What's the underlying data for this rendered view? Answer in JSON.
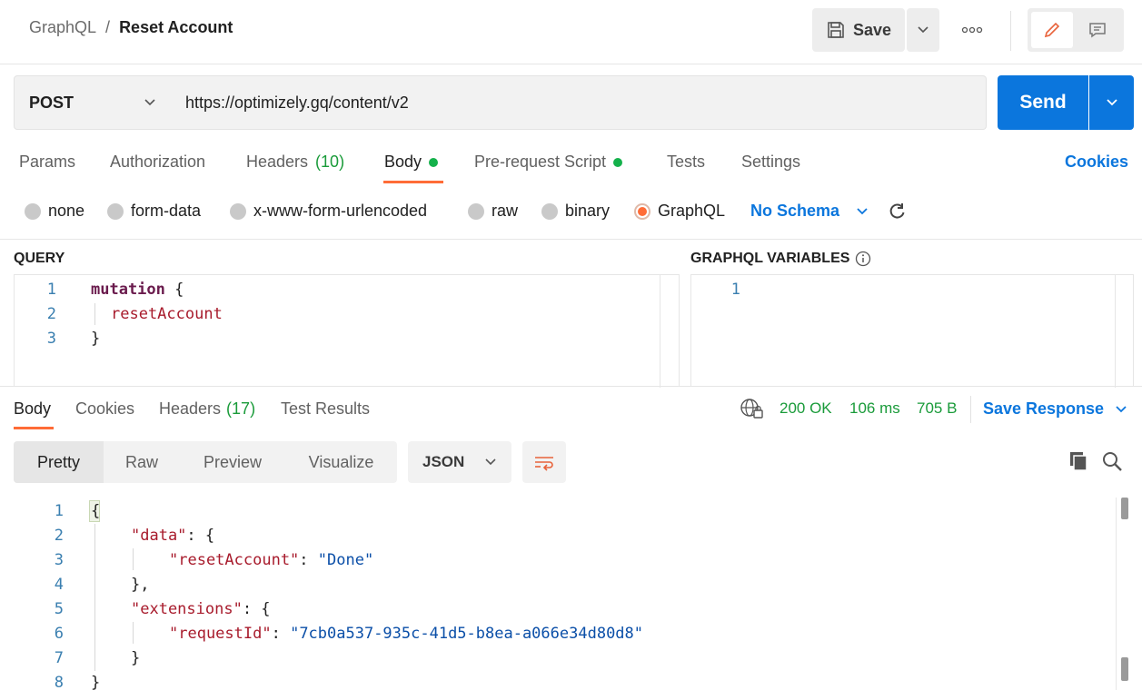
{
  "header": {
    "breadcrumb_parent": "GraphQL",
    "breadcrumb_sep": "/",
    "title": "Reset Account",
    "save_label": "Save"
  },
  "request": {
    "method": "POST",
    "url": "https://optimizely.gq/content/v2",
    "send_label": "Send"
  },
  "tabs": [
    {
      "label": "Params"
    },
    {
      "label": "Authorization"
    },
    {
      "label": "Headers",
      "count": "(10)"
    },
    {
      "label": "Body"
    },
    {
      "label": "Pre-request Script"
    },
    {
      "label": "Tests"
    },
    {
      "label": "Settings"
    }
  ],
  "cookies_link": "Cookies",
  "body_types": [
    "none",
    "form-data",
    "x-www-form-urlencoded",
    "raw",
    "binary",
    "GraphQL"
  ],
  "schema_label": "No Schema",
  "query": {
    "label": "QUERY",
    "lines": [
      {
        "n": "1",
        "kw": "mutation",
        "rest": " {"
      },
      {
        "n": "2",
        "text": "resetAccount"
      },
      {
        "n": "3",
        "text": "}"
      }
    ]
  },
  "variables": {
    "label": "GRAPHQL VARIABLES",
    "lines": [
      {
        "n": "1"
      }
    ]
  },
  "response": {
    "tabs": [
      {
        "label": "Body"
      },
      {
        "label": "Cookies"
      },
      {
        "label": "Headers",
        "count": "(17)"
      },
      {
        "label": "Test Results"
      }
    ],
    "status": "200 OK",
    "time": "106 ms",
    "size": "705 B",
    "save_label": "Save Response",
    "views": [
      "Pretty",
      "Raw",
      "Preview",
      "Visualize"
    ],
    "format": "JSON",
    "line_numbers": [
      "1",
      "2",
      "3",
      "4",
      "5",
      "6",
      "7",
      "8"
    ],
    "json": {
      "l1": "{",
      "l2_key": "\"data\"",
      "l2_rest": ": {",
      "l3_key": "\"resetAccount\"",
      "l3_sep": ": ",
      "l3_val": "\"Done\"",
      "l4": "},",
      "l5_key": "\"extensions\"",
      "l5_rest": ": {",
      "l6_key": "\"requestId\"",
      "l6_sep": ": ",
      "l6_val": "\"7cb0a537-935c-41d5-b8ea-a066e34d80d8\"",
      "l7": "}",
      "l8": "}"
    }
  }
}
